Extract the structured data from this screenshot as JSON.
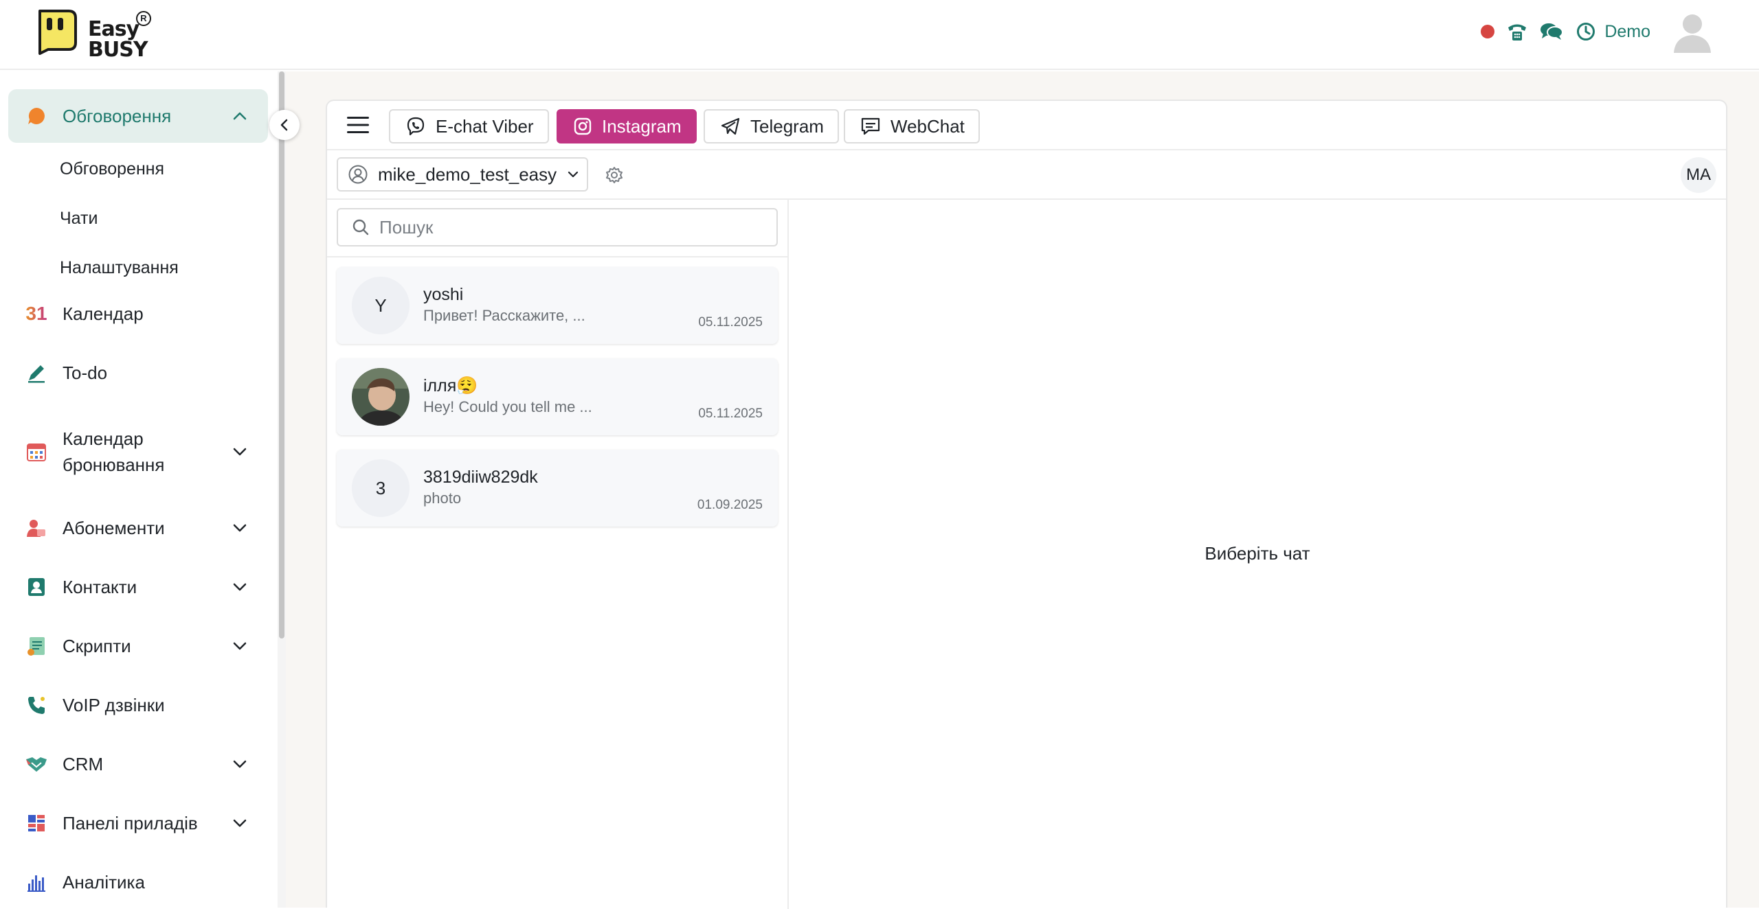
{
  "header": {
    "logo_text_top": "Easy",
    "logo_text_bottom": "BUSY",
    "logo_registered": "R",
    "user_label": "Demo"
  },
  "sidebar": {
    "items": [
      {
        "label": "Обговорення",
        "icon": "chat-bubble-icon",
        "active": true,
        "expanded": true
      },
      {
        "label": "Календар",
        "icon": "calendar-31-icon"
      },
      {
        "label": "To-do",
        "icon": "pencil-icon"
      },
      {
        "label": "Календар бронювання",
        "icon": "booking-calendar-icon",
        "expandable": true
      },
      {
        "label": "Абонементи",
        "icon": "subscriptions-icon",
        "expandable": true
      },
      {
        "label": "Контакти",
        "icon": "contacts-icon",
        "expandable": true
      },
      {
        "label": "Скрипти",
        "icon": "scripts-icon",
        "expandable": true
      },
      {
        "label": "VoIP дзвінки",
        "icon": "voip-phone-icon"
      },
      {
        "label": "CRM",
        "icon": "crm-handshake-icon",
        "expandable": true
      },
      {
        "label": "Панелі приладів",
        "icon": "dashboards-icon",
        "expandable": true
      },
      {
        "label": "Аналітика",
        "icon": "analytics-icon"
      }
    ],
    "subitems": [
      "Обговорення",
      "Чати",
      "Налаштування"
    ],
    "calendar_icon_text": "31"
  },
  "channels": {
    "tabs": [
      {
        "label": "E-chat Viber",
        "icon": "viber-icon"
      },
      {
        "label": "Instagram",
        "icon": "instagram-icon",
        "active": true
      },
      {
        "label": "Telegram",
        "icon": "telegram-icon"
      },
      {
        "label": "WebChat",
        "icon": "webchat-icon"
      }
    ]
  },
  "account": {
    "selected": "mike_demo_test_easy",
    "user_initials": "MA"
  },
  "search": {
    "placeholder": "Пошук",
    "value": ""
  },
  "chats": [
    {
      "initial": "Y",
      "name": "yoshi",
      "preview": "Привет! Расскажите, ...",
      "date": "05.11.2025"
    },
    {
      "initial": "",
      "name": "ілля😮‍💨",
      "preview": "Hey! Could you tell me ...",
      "date": "05.11.2025",
      "has_photo": true
    },
    {
      "initial": "3",
      "name": "3819diiw829dk",
      "preview": "photo",
      "date": "01.09.2025"
    }
  ],
  "empty_state": {
    "text": "Виберіть чат"
  },
  "colors": {
    "accent": "#1f7a6d",
    "instagram": "#c13584",
    "recording": "#d64541",
    "logo_yellow": "#f5e663"
  }
}
